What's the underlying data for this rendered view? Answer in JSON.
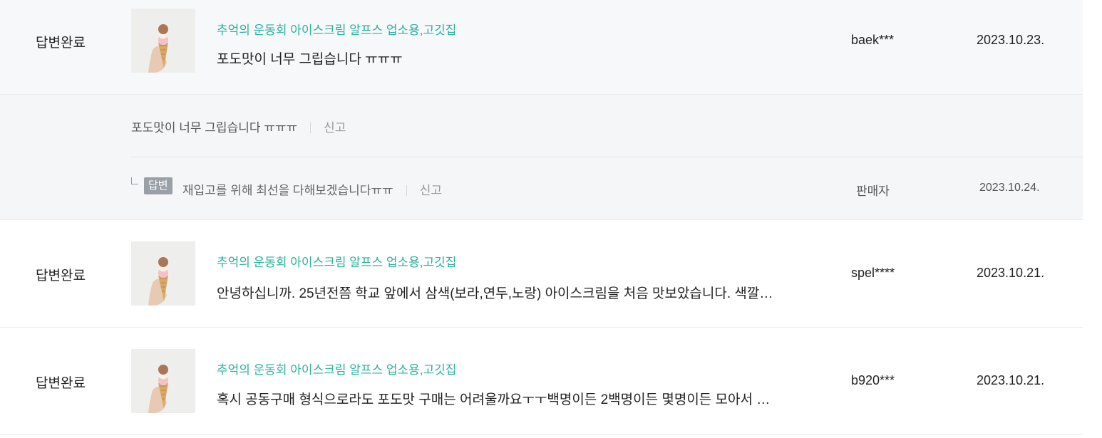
{
  "reviews": [
    {
      "status": "답변완료",
      "product": "추억의 운동회 아이스크림 알프스 업소용,고깃집",
      "title": "포도맛이 너무 그립습니다 ㅠㅠㅠ",
      "user": "baek***",
      "date": "2023.10.23."
    },
    {
      "status": "답변완료",
      "product": "추억의 운동회 아이스크림 알프스 업소용,고깃집",
      "title": "안녕하십니까. 25년전쯤 학교 앞에서 삼색(보라,연두,노랑) 아이스크림을 처음 맛보았습니다. 색깔…",
      "user": "spel****",
      "date": "2023.10.21."
    },
    {
      "status": "답변완료",
      "product": "추억의 운동회 아이스크림 알프스 업소용,고깃집",
      "title": "혹시 공동구매 형식으로라도 포도맛 구매는 어려울까요ㅜㅜ백명이든 2백명이든 몇명이든 모아서 …",
      "user": "b920***",
      "date": "2023.10.21."
    }
  ],
  "detail": {
    "content": "포도맛이 너무 그립습니다 ㅠㅠㅠ",
    "report_label": "신고",
    "reply": {
      "badge": "답변",
      "text": "재입고를 위해 최선을 다해보겠습니다ㅠㅠ",
      "report_label": "신고",
      "author": "판매자",
      "date": "2023.10.24."
    }
  },
  "icons": {
    "thumbnail": "ice-cream-cone-image"
  },
  "colors": {
    "product_link": "#2bb0a0",
    "expanded_bg": "#f5f6f8",
    "badge_bg": "#9aa0a8"
  }
}
